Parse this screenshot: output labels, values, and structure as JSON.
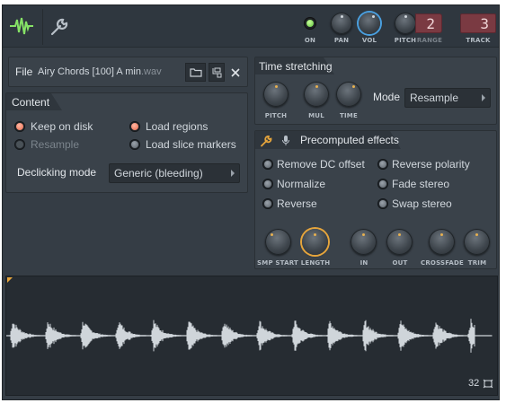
{
  "header": {
    "logo_icon": "waveform-logo-icon",
    "settings_icon": "wrench-icon",
    "on_label": "ON",
    "pan_label": "PAN",
    "vol_label": "VOL",
    "pitch_label": "PITCH",
    "range_label": "RANGE",
    "range_value": "2",
    "track_label": "TRACK",
    "track_value": "3"
  },
  "file": {
    "label": "File",
    "name": "Airy Chords [100] A min",
    "ext": ".wav",
    "open_icon": "folder-icon",
    "locate_icon": "browse-tree-icon",
    "close_icon": "close-icon"
  },
  "content": {
    "title": "Content",
    "options": [
      {
        "label": "Keep on disk",
        "state": "on"
      },
      {
        "label": "Load regions",
        "state": "on"
      },
      {
        "label": "Resample",
        "state": "disabled"
      },
      {
        "label": "Load slice markers",
        "state": "off"
      }
    ],
    "declick_label": "Declicking mode",
    "declick_value": "Generic (bleeding)"
  },
  "time_stretching": {
    "title": "Time stretching",
    "knobs": [
      "PITCH",
      "MUL",
      "TIME"
    ],
    "mode_label": "Mode",
    "mode_value": "Resample"
  },
  "precomputed": {
    "title": "Precomputed effects",
    "options": [
      "Remove DC offset",
      "Reverse polarity",
      "Normalize",
      "Fade stereo",
      "Reverse",
      "Swap stereo"
    ],
    "knobs": [
      "SMP START",
      "LENGTH",
      "IN",
      "OUT",
      "CROSSFADE",
      "TRIM"
    ]
  },
  "waveform": {
    "zoom_value": "32",
    "zoom_icon": "fit-view-icon"
  },
  "colors": {
    "accent": "#e6a53c",
    "active_radio": "#e8684a",
    "waveform": "#cfd5da",
    "on_led": "#7be05a"
  }
}
